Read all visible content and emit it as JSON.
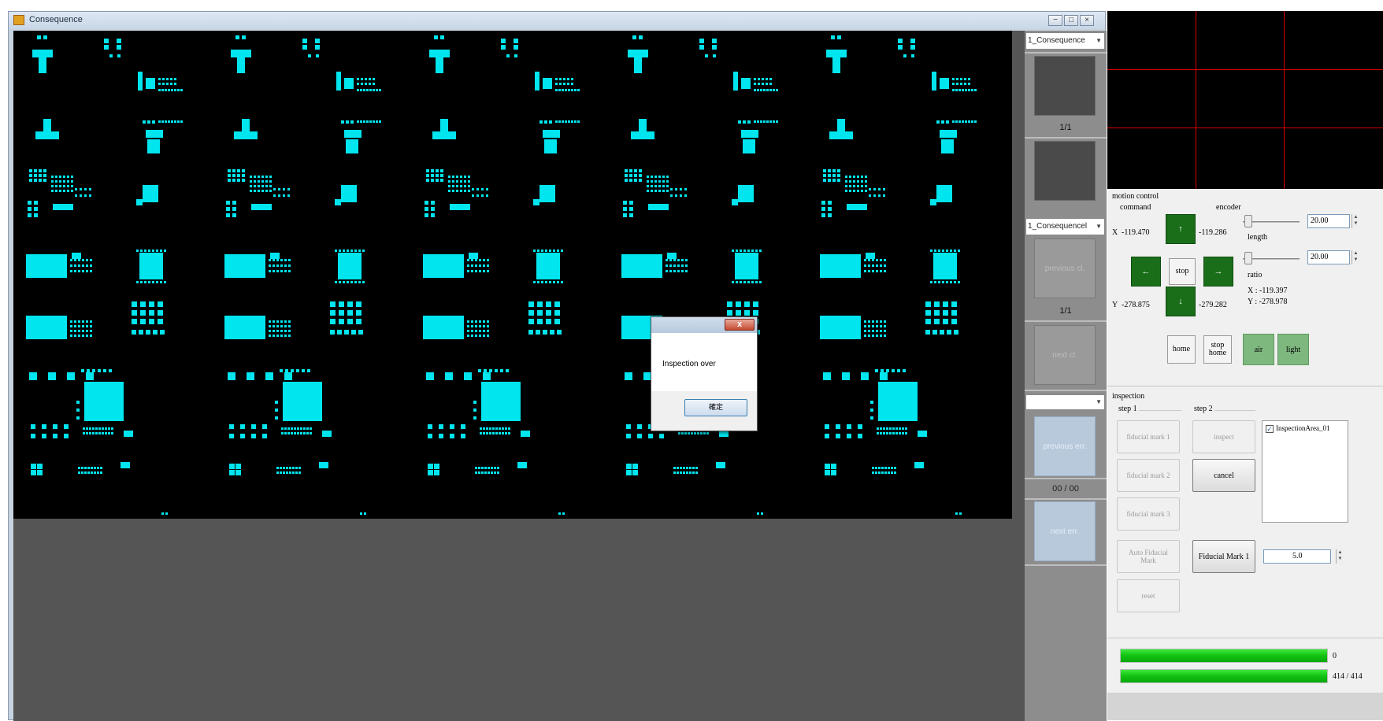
{
  "window": {
    "title": "Consequence",
    "minimize_glyph": "−",
    "restore_glyph": "□",
    "close_glyph": "×"
  },
  "colors": {
    "pad": "#00e5ee",
    "viewer_bg": "#000000",
    "crosshair": "#d80000",
    "green_button": "#1a6e1a",
    "light_green_button": "#7fb87f",
    "progress": "#12c212"
  },
  "nav": {
    "select1": "1_Consequence",
    "counter1": "1/1",
    "select2": "1_Consequencel",
    "previous_cl": "previous cl.",
    "counter2": "1/1",
    "next_cl": "next cl.",
    "select3": "",
    "previous_err": "previous err.",
    "err_counter": "00 / 00",
    "next_err": "next err."
  },
  "motion": {
    "group_title": "motion control",
    "command_label": "command",
    "encoder_label": "encoder",
    "x_label": "X",
    "x_command": "-119.470",
    "x_encoder": "-119.286",
    "y_label": "Y",
    "y_command": "-278.875",
    "y_encoder": "-279.282",
    "up_glyph": "↑",
    "down_glyph": "↓",
    "left_glyph": "←",
    "right_glyph": "→",
    "stop": "stop",
    "length_label": "length",
    "length_value": "20.00",
    "ratio_label": "ratio",
    "ratio_value": "20.00",
    "x_readout": "X : -119.397",
    "y_readout": "Y : -278.978",
    "home": "home",
    "stop_home": "stop home",
    "air": "air",
    "light": "light",
    "spin_up": "▲",
    "spin_down": "▼"
  },
  "inspection": {
    "group_title": "inspection",
    "step1": "step 1",
    "step2": "step 2",
    "fiducial1": "fiducial mark 1",
    "fiducial2": "fiducial mark 2",
    "fiducial3": "fiducial mark 3",
    "inspect": "inspect",
    "cancel": "cancel",
    "area_item": "InspectionArea_01",
    "checkmark": "✓",
    "auto_fiducial": "Auto Fiducial Mark",
    "fiducial_mark_button": "Fiducial Mark 1",
    "fiducial_value": "5.0",
    "reset": "reset"
  },
  "progress": {
    "bar1_value": 1.0,
    "bar1_label": "0",
    "bar2_value": 1.0,
    "bar2_label": "414 / 414"
  },
  "dialog": {
    "close_glyph": "x",
    "message": "Inspection over",
    "ok": "確定"
  }
}
